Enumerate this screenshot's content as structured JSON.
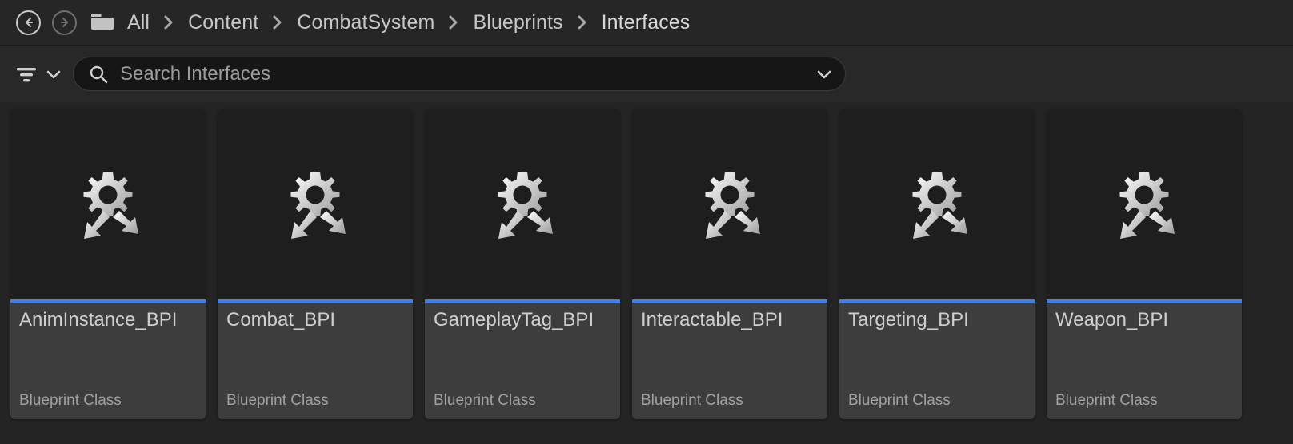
{
  "breadcrumb": {
    "back_label": "Back",
    "forward_label": "Forward",
    "folder_icon": "folder-icon",
    "separator": "›",
    "items": [
      {
        "label": "All"
      },
      {
        "label": "Content"
      },
      {
        "label": "CombatSystem"
      },
      {
        "label": "Blueprints"
      },
      {
        "label": "Interfaces"
      }
    ]
  },
  "toolbar": {
    "filter_icon": "filter-icon",
    "filter_chevron_icon": "chevron-down-icon",
    "filter_label": "Filters"
  },
  "search": {
    "icon": "search-icon",
    "placeholder": "Search Interfaces",
    "value": "",
    "chevron_icon": "chevron-down-icon"
  },
  "assets": {
    "accent_color": "#3d7ff0",
    "thumbnail_icon": "blueprint-interface-icon",
    "items": [
      {
        "name": "AnimInstance_BPI",
        "type": "Blueprint Class"
      },
      {
        "name": "Combat_BPI",
        "type": "Blueprint Class"
      },
      {
        "name": "GameplayTag_BPI",
        "type": "Blueprint Class"
      },
      {
        "name": "Interactable_BPI",
        "type": "Blueprint Class"
      },
      {
        "name": "Targeting_BPI",
        "type": "Blueprint Class"
      },
      {
        "name": "Weapon_BPI",
        "type": "Blueprint Class"
      }
    ]
  },
  "colors": {
    "header_background": "#262626",
    "toolbar_background": "#282828",
    "content_background": "#242424",
    "tile_thumb_background": "#1e1e1e",
    "tile_footer_background": "#3d3d3d",
    "accent": "#3d7ff0"
  }
}
